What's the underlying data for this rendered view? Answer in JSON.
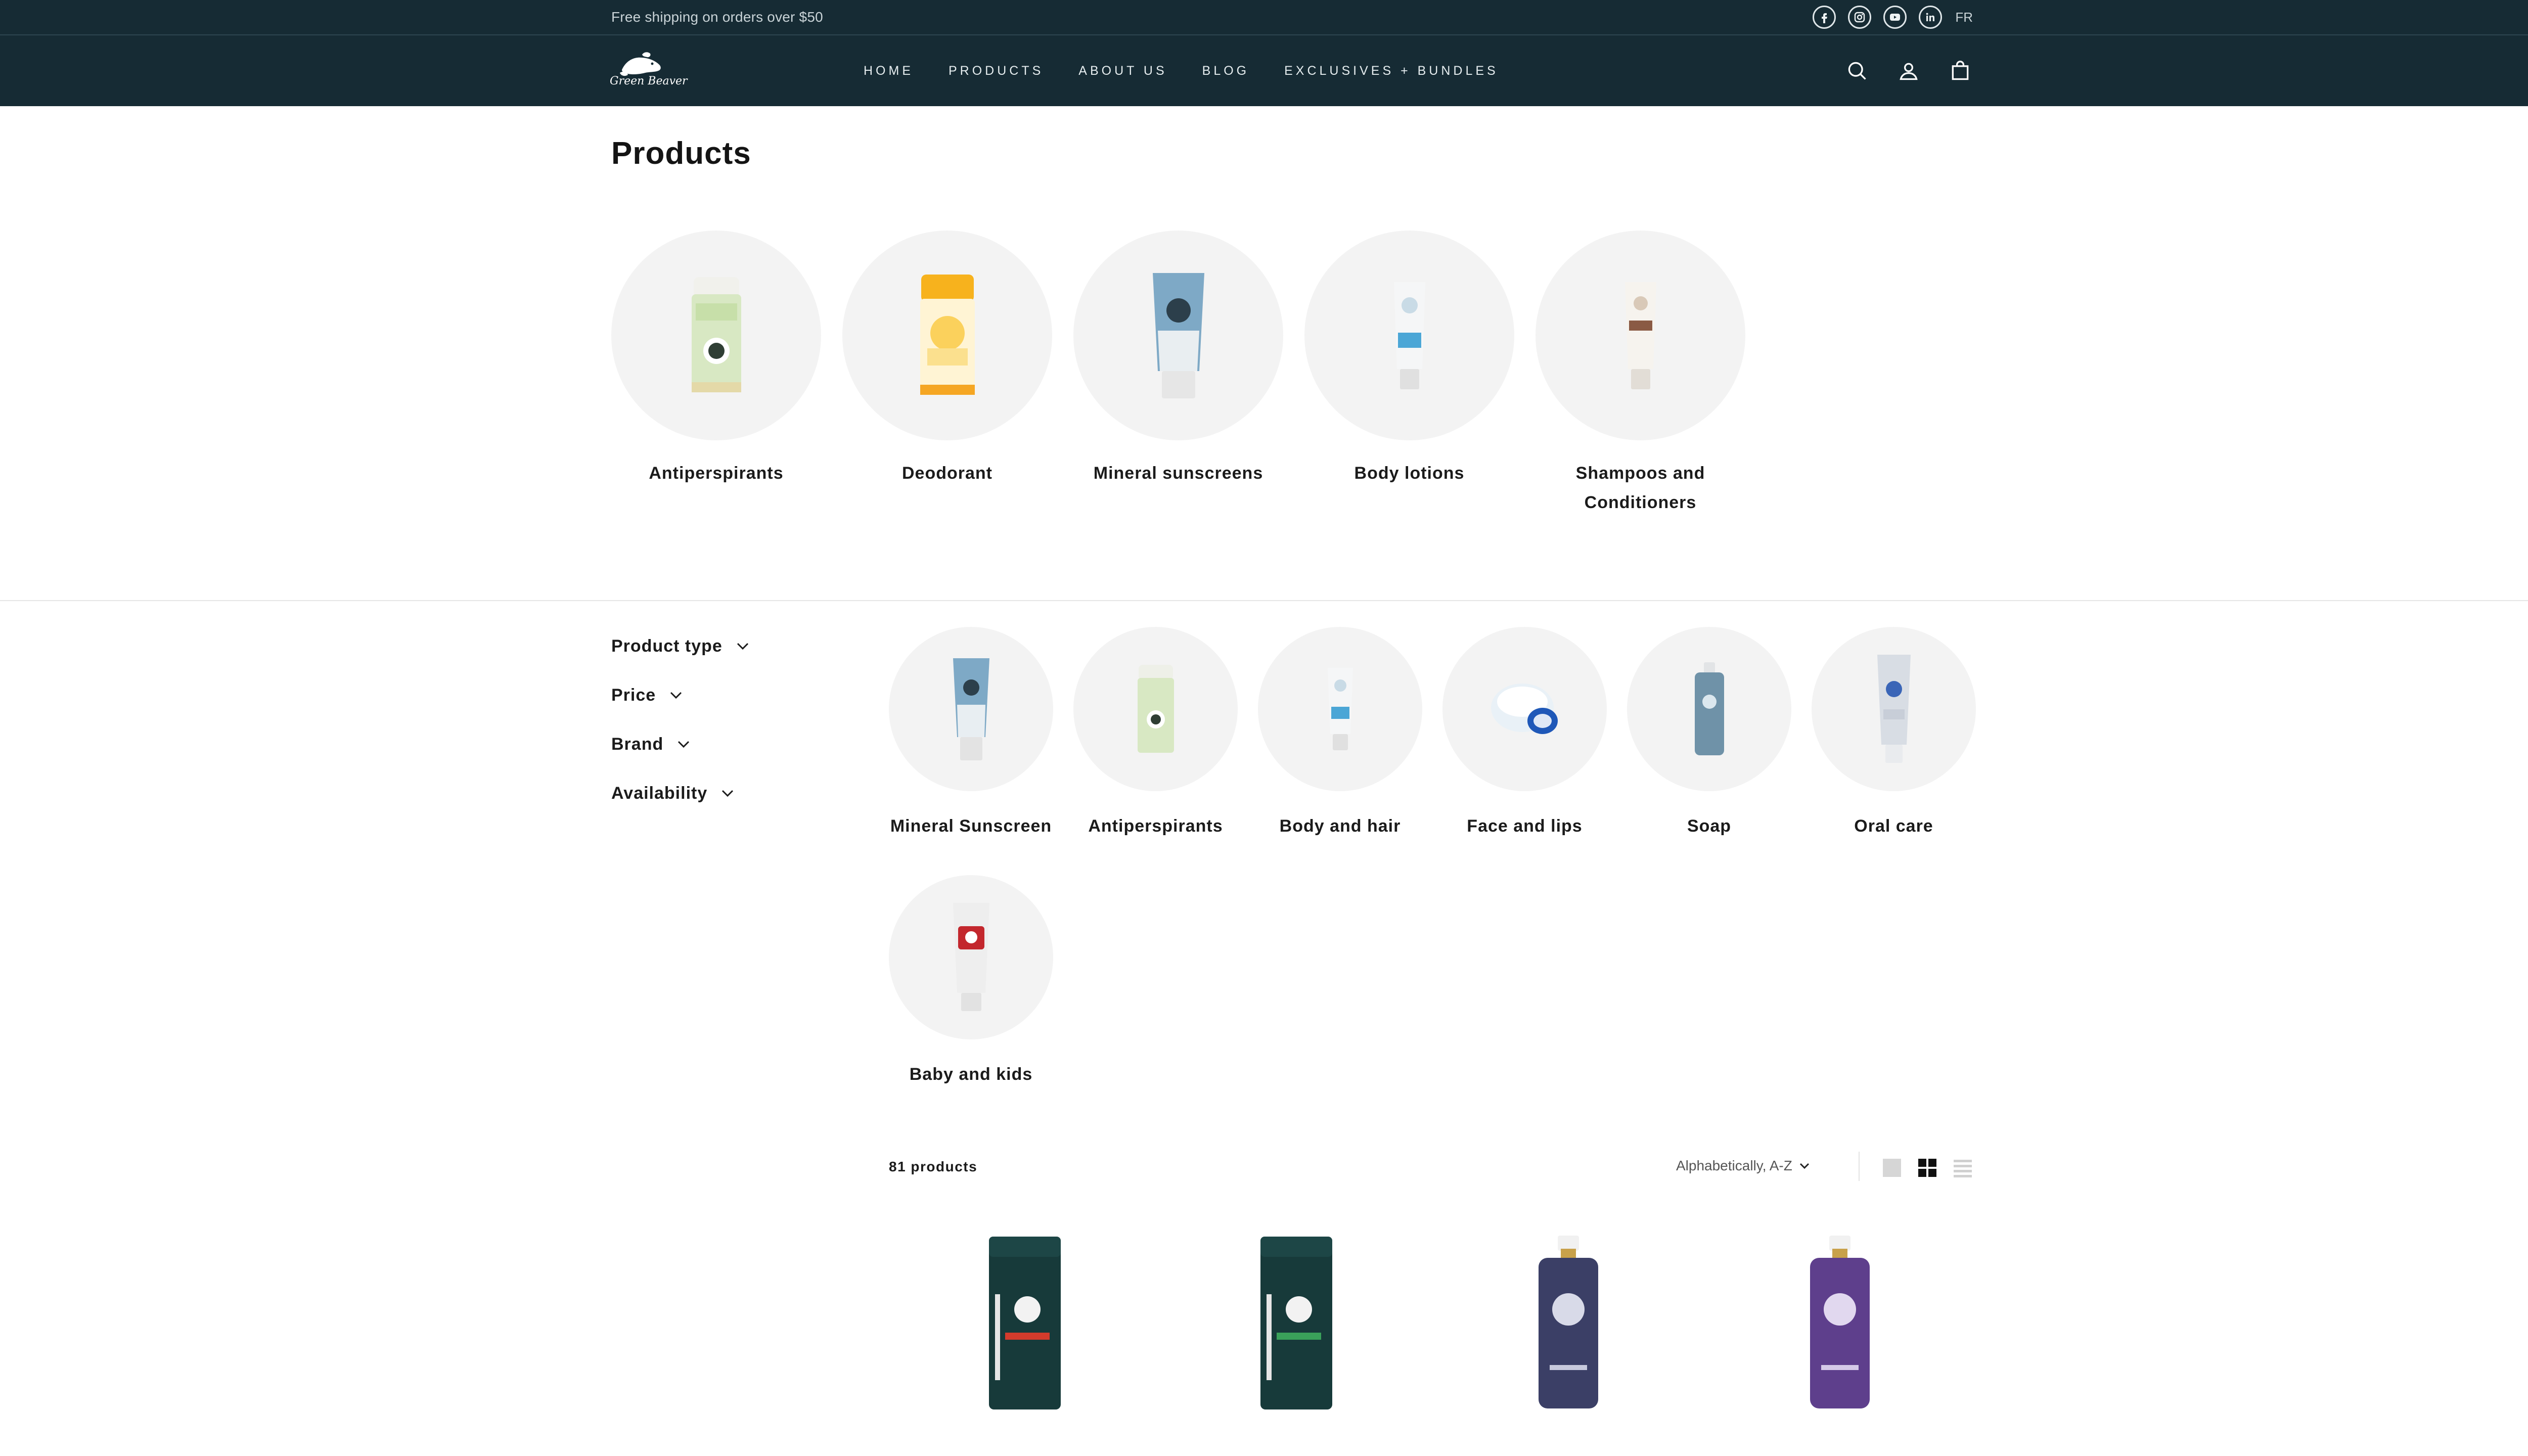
{
  "announcement": {
    "text": "Free shipping on orders over $50",
    "language": "FR"
  },
  "social": [
    "facebook-icon",
    "instagram-icon",
    "youtube-icon",
    "linkedin-icon"
  ],
  "brand": {
    "name": "Green Beaver"
  },
  "nav": {
    "items": [
      "HOME",
      "PRODUCTS",
      "ABOUT US",
      "BLOG",
      "EXCLUSIVES + BUNDLES"
    ]
  },
  "header_icons": [
    "search-icon",
    "account-icon",
    "cart-icon"
  ],
  "page": {
    "title": "Products"
  },
  "collections": [
    {
      "label": "Antiperspirants"
    },
    {
      "label": "Deodorant"
    },
    {
      "label": "Mineral sunscreens"
    },
    {
      "label": "Body lotions"
    },
    {
      "label": "Shampoos and Conditioners"
    }
  ],
  "filters": [
    {
      "label": "Product type"
    },
    {
      "label": "Price"
    },
    {
      "label": "Brand"
    },
    {
      "label": "Availability"
    }
  ],
  "product_types": [
    {
      "label": "Mineral Sunscreen"
    },
    {
      "label": "Antiperspirants"
    },
    {
      "label": "Body and hair"
    },
    {
      "label": "Face and lips"
    },
    {
      "label": "Soap"
    },
    {
      "label": "Oral care"
    },
    {
      "label": "Baby and kids"
    }
  ],
  "toolbar": {
    "count": "81 products",
    "sort": "Alphabetically, A-Z",
    "views": [
      "large-grid-icon",
      "small-grid-icon",
      "list-icon"
    ]
  },
  "colors": {
    "header_bg": "#162b34",
    "circle_bg": "#f3f3f3",
    "text": "#1b1b1b"
  }
}
